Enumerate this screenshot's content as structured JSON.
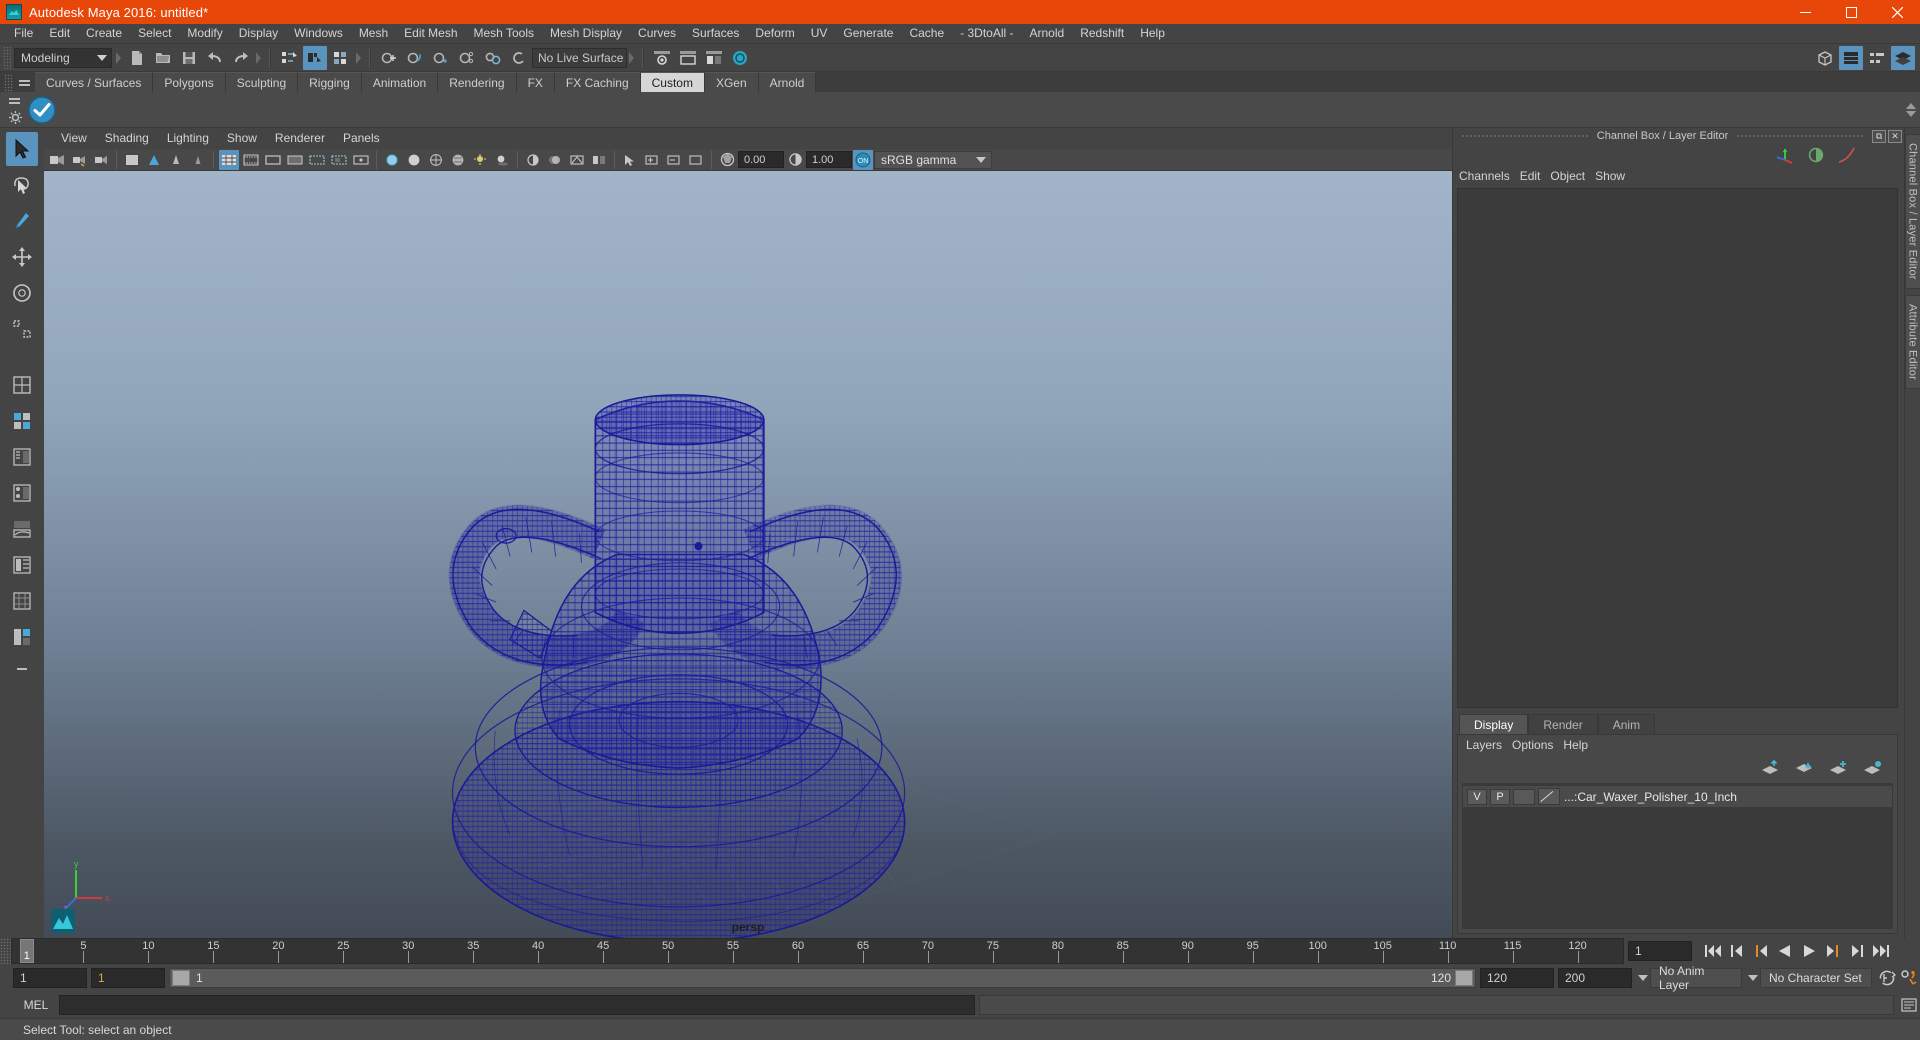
{
  "window": {
    "title": "Autodesk Maya 2016: untitled*",
    "minimize": "–",
    "maximize": "❐",
    "close": "✕"
  },
  "menubar": {
    "items": [
      "File",
      "Edit",
      "Create",
      "Select",
      "Modify",
      "Display",
      "Windows",
      "Mesh",
      "Edit Mesh",
      "Mesh Tools",
      "Mesh Display",
      "Curves",
      "Surfaces",
      "Deform",
      "UV",
      "Generate",
      "Cache",
      "- 3DtoAll -",
      "Arnold",
      "Redshift",
      "Help"
    ]
  },
  "toolbar": {
    "menuset": "Modeling",
    "live_surface": "No Live Surface"
  },
  "shelf": {
    "tabs": [
      "Curves / Surfaces",
      "Polygons",
      "Sculpting",
      "Rigging",
      "Animation",
      "Rendering",
      "FX",
      "FX Caching",
      "Custom",
      "XGen",
      "Arnold"
    ],
    "selected": "Custom"
  },
  "panel": {
    "menus": [
      "View",
      "Shading",
      "Lighting",
      "Show",
      "Renderer",
      "Panels"
    ],
    "exposure": "0.00",
    "gamma": "1.00",
    "color_management": "sRGB gamma",
    "camera_label": "persp",
    "axis": {
      "x": "x",
      "y": "y",
      "z": "z"
    }
  },
  "channelbox": {
    "dock_title": "Channel Box / Layer Editor",
    "menus": [
      "Channels",
      "Edit",
      "Object",
      "Show"
    ]
  },
  "layer_editor": {
    "tabs": [
      "Display",
      "Render",
      "Anim"
    ],
    "selected_tab": "Display",
    "menus": [
      "Layers",
      "Options",
      "Help"
    ],
    "layers": [
      {
        "visibility": "V",
        "playback": "P",
        "name": "...:Car_Waxer_Polisher_10_Inch"
      }
    ]
  },
  "vertical_tabs": [
    "Channel Box / Layer Editor",
    "Attribute Editor"
  ],
  "timeline": {
    "ticks": [
      "5",
      "10",
      "15",
      "20",
      "25",
      "30",
      "35",
      "40",
      "45",
      "50",
      "55",
      "60",
      "65",
      "70",
      "75",
      "80",
      "85",
      "90",
      "95",
      "100",
      "105",
      "110",
      "115",
      "120"
    ],
    "current_frame": "1",
    "playhead_label": "1"
  },
  "range": {
    "start": "1",
    "anim_start": "1",
    "slider_min": "1",
    "slider_max": "120",
    "anim_end": "120",
    "end": "200",
    "anim_layer": "No Anim Layer",
    "character_set": "No Character Set"
  },
  "command_line": {
    "language": "MEL",
    "input_value": "",
    "output_value": ""
  },
  "status": {
    "help_text": "Select Tool: select an object"
  },
  "colors": {
    "title_bar": "#e8470a",
    "accent_blue": "#5a93bd",
    "wireframe": "#1f1fa0",
    "orange": "#e08a20"
  }
}
